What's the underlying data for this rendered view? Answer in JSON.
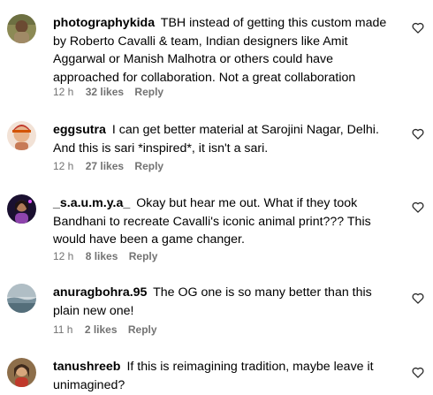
{
  "comments": [
    {
      "username": "photographykida",
      "text": "TBH instead of getting this custom made by Roberto Cavalli & team, Indian designers like Amit Aggarwal or Manish Malhotra or others could have approached for collaboration. Not a great collaboration",
      "time": "12 h",
      "likes": "32 likes",
      "reply": "Reply",
      "avatar_icon": "profile-photo"
    },
    {
      "username": "eggsutra",
      "text": "I can get better material at Sarojini Nagar, Delhi. And this is sari *inspired*, it isn't a sari.",
      "time": "12 h",
      "likes": "27 likes",
      "reply": "Reply",
      "avatar_icon": "profile-photo"
    },
    {
      "username": "_s.a.u.m.y.a_",
      "text": "Okay but hear me out. What if they took Bandhani to recreate Cavalli's iconic animal print??? This would have been a game changer.",
      "time": "12 h",
      "likes": "8 likes",
      "reply": "Reply",
      "avatar_icon": "profile-photo"
    },
    {
      "username": "anuragbohra.95",
      "text": "The OG one is so many better than this plain new one!",
      "time": "11 h",
      "likes": "2 likes",
      "reply": "Reply",
      "avatar_icon": "profile-photo"
    },
    {
      "username": "tanushreeb",
      "text": "If this is reimagining tradition, maybe leave it unimagined?",
      "time": "",
      "likes": "",
      "reply": "",
      "avatar_icon": "profile-photo"
    }
  ],
  "colors": {
    "text": "#000000",
    "meta": "#737373",
    "heart_stroke": "#262626"
  },
  "icons": {
    "like": "heart-outline-icon"
  }
}
